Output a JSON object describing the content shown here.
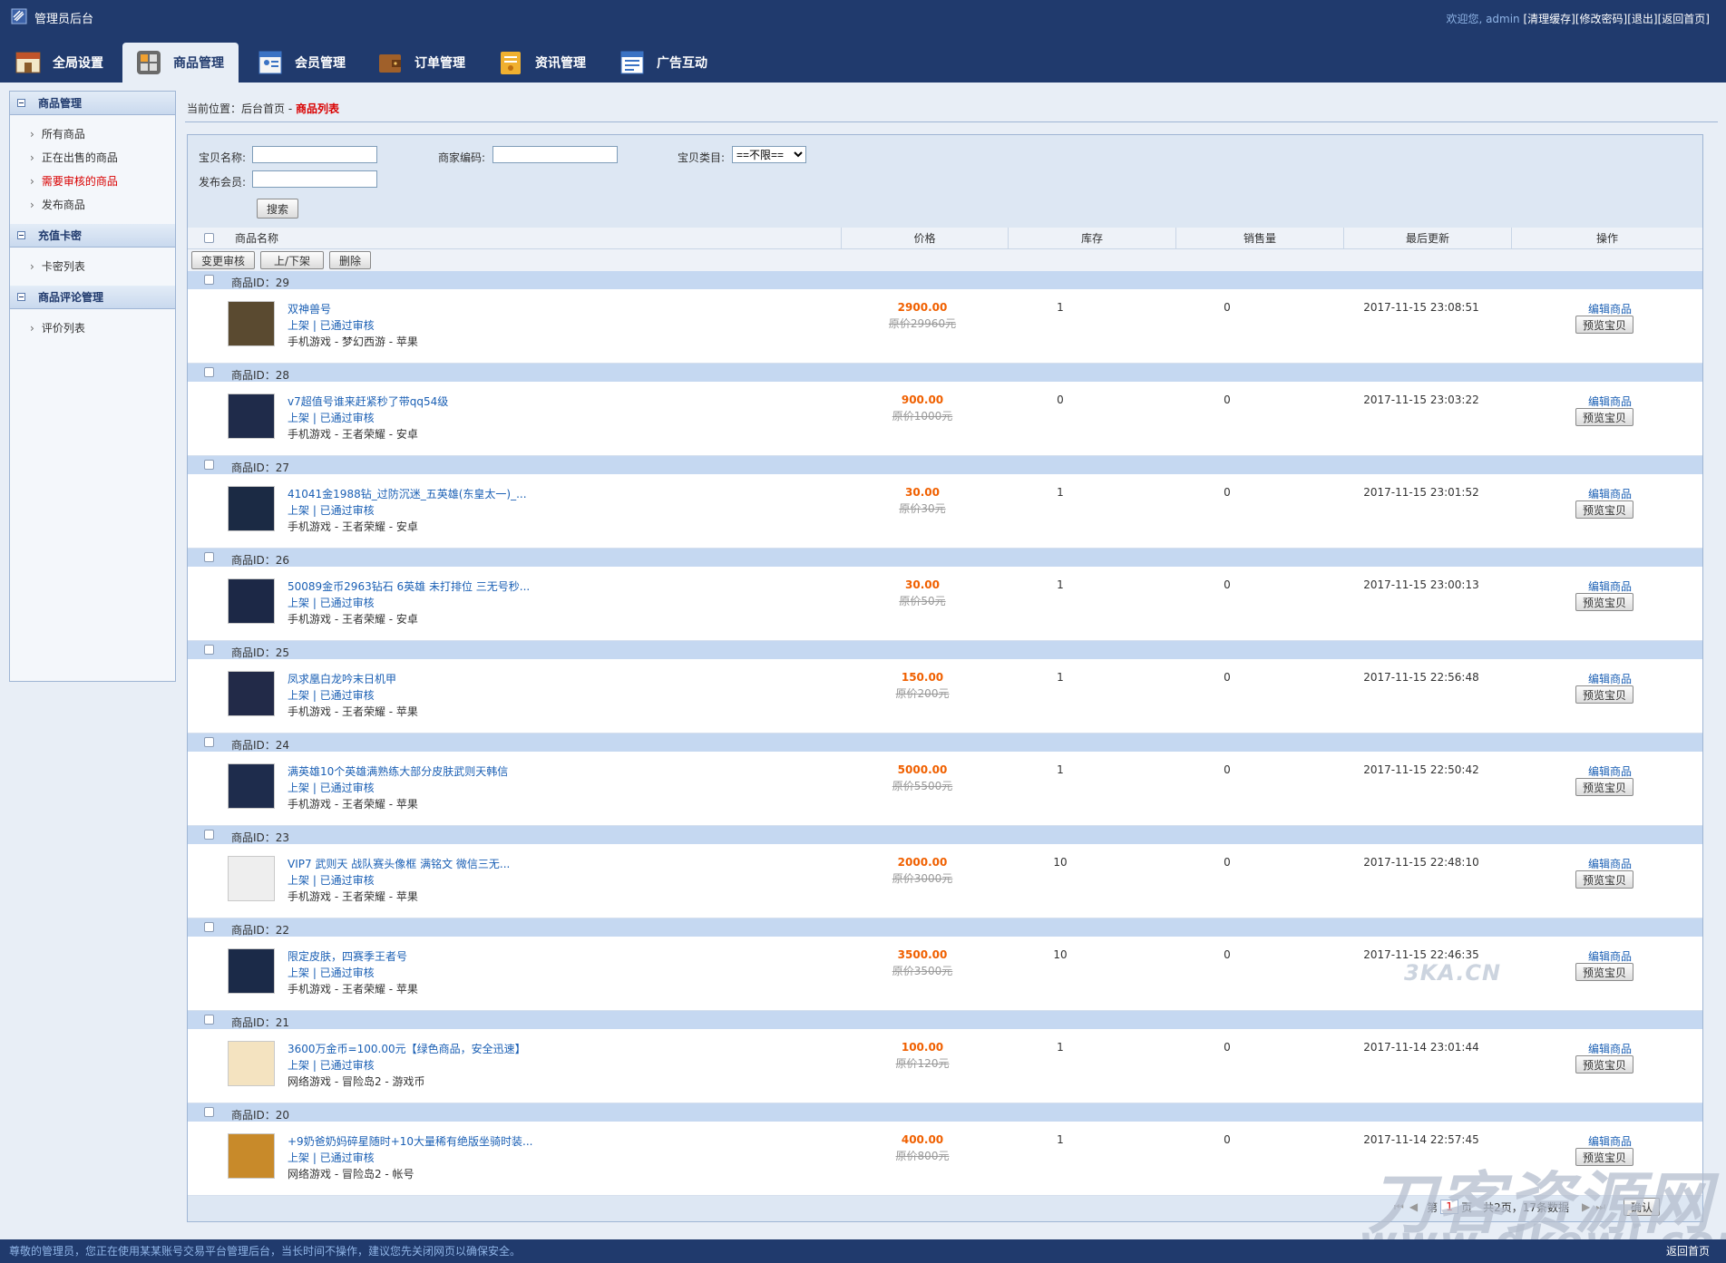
{
  "header": {
    "title": "管理员后台",
    "welcome": "欢迎您, admin",
    "links": [
      "[清理缓存]",
      "[修改密码]",
      "[退出]",
      "[返回首页]"
    ]
  },
  "nav": {
    "tabs": [
      {
        "label": "全局设置",
        "icon": "home-icon"
      },
      {
        "label": "商品管理",
        "icon": "grid-icon"
      },
      {
        "label": "会员管理",
        "icon": "member-icon"
      },
      {
        "label": "订单管理",
        "icon": "wallet-icon"
      },
      {
        "label": "资讯管理",
        "icon": "news-icon"
      },
      {
        "label": "广告互动",
        "icon": "ad-icon"
      }
    ]
  },
  "sidebar": {
    "groups": [
      {
        "title": "商品管理",
        "items": [
          "所有商品",
          "正在出售的商品",
          "需要审核的商品",
          "发布商品"
        ]
      },
      {
        "title": "充值卡密",
        "items": [
          "卡密列表"
        ]
      },
      {
        "title": "商品评论管理",
        "items": [
          "评价列表"
        ]
      }
    ]
  },
  "breadcrumb": {
    "prefix": "当前位置：",
    "home": "后台首页",
    "sep": " - ",
    "current": "商品列表"
  },
  "search": {
    "name_label": "宝贝名称:",
    "code_label": "商家编码:",
    "cat_label": "宝贝类目:",
    "cat_value": "==不限==",
    "member_label": "发布会员:",
    "search_button": "搜索"
  },
  "table": {
    "headers": [
      "商品名称",
      "价格",
      "库存",
      "销售量",
      "最后更新",
      "操作"
    ],
    "actions": [
      "变更审核",
      "上/下架",
      "删除"
    ],
    "id_prefix": "商品ID：",
    "edit_label": "编辑商品",
    "preview_label": "预览宝贝",
    "rows": [
      {
        "id": "29",
        "name": "双神兽号",
        "status": "上架 | 已通过审核",
        "category": "手机游戏 - 梦幻西游 - 苹果",
        "price": "2900.00",
        "orig": "原价29960元",
        "stock": "1",
        "sold": "0",
        "updated": "2017-11-15 23:08:51",
        "thumb": "#5a4a30"
      },
      {
        "id": "28",
        "name": "v7超值号谁来赶紧秒了带qq54级",
        "status": "上架 | 已通过审核",
        "category": "手机游戏 - 王者荣耀 - 安卓",
        "price": "900.00",
        "orig": "原价1000元",
        "stock": "0",
        "sold": "0",
        "updated": "2017-11-15 23:03:22",
        "thumb": "#1f2b4a"
      },
      {
        "id": "27",
        "name": "41041金1988钻_过防沉迷_五英雄(东皇太一)_...",
        "status": "上架 | 已通过审核",
        "category": "手机游戏 - 王者荣耀 - 安卓",
        "price": "30.00",
        "orig": "原价30元",
        "stock": "1",
        "sold": "0",
        "updated": "2017-11-15 23:01:52",
        "thumb": "#1b2a44"
      },
      {
        "id": "26",
        "name": "50089金币2963钻石 6英雄 未打排位 三无号秒...",
        "status": "上架 | 已通过审核",
        "category": "手机游戏 - 王者荣耀 - 安卓",
        "price": "30.00",
        "orig": "原价50元",
        "stock": "1",
        "sold": "0",
        "updated": "2017-11-15 23:00:13",
        "thumb": "#1c2846"
      },
      {
        "id": "25",
        "name": "凤求凰白龙吟末日机甲",
        "status": "上架 | 已通过审核",
        "category": "手机游戏 - 王者荣耀 - 苹果",
        "price": "150.00",
        "orig": "原价200元",
        "stock": "1",
        "sold": "0",
        "updated": "2017-11-15 22:56:48",
        "thumb": "#222a48"
      },
      {
        "id": "24",
        "name": "满英雄10个英雄满熟练大部分皮肤武则天韩信",
        "status": "上架 | 已通过审核",
        "category": "手机游戏 - 王者荣耀 - 苹果",
        "price": "5000.00",
        "orig": "原价5500元",
        "stock": "1",
        "sold": "0",
        "updated": "2017-11-15 22:50:42",
        "thumb": "#1e2c4c"
      },
      {
        "id": "23",
        "name": "VIP7 武则天 战队赛头像框 满铭文 微信三无...",
        "status": "上架 | 已通过审核",
        "category": "手机游戏 - 王者荣耀 - 苹果",
        "price": "2000.00",
        "orig": "原价3000元",
        "stock": "10",
        "sold": "0",
        "updated": "2017-11-15 22:48:10",
        "thumb": "#eeeeee"
      },
      {
        "id": "22",
        "name": "限定皮肤，四赛季王者号",
        "status": "上架 | 已通过审核",
        "category": "手机游戏 - 王者荣耀 - 苹果",
        "price": "3500.00",
        "orig": "原价3500元",
        "stock": "10",
        "sold": "0",
        "updated": "2017-11-15 22:46:35",
        "thumb": "#1b2a48"
      },
      {
        "id": "21",
        "name": "3600万金币=100.00元【绿色商品，安全迅速】",
        "status": "上架 | 已通过审核",
        "category": "网络游戏 - 冒险岛2 - 游戏币",
        "price": "100.00",
        "orig": "原价120元",
        "stock": "1",
        "sold": "0",
        "updated": "2017-11-14 23:01:44",
        "thumb": "#f4e3c0"
      },
      {
        "id": "20",
        "name": "+9奶爸奶妈碎星随时+10大量稀有绝版坐骑时装...",
        "status": "上架 | 已通过审核",
        "category": "网络游戏 - 冒险岛2 - 帐号",
        "price": "400.00",
        "orig": "原价800元",
        "stock": "1",
        "sold": "0",
        "updated": "2017-11-14 22:57:45",
        "thumb": "#c88a2a"
      }
    ]
  },
  "pager": {
    "prefix": "第",
    "page": "1",
    "suffix": "页",
    "summary": "共2页，17条数据",
    "confirm": "确认"
  },
  "footer": {
    "notice": "尊敬的管理员，您正在使用某某账号交易平台管理后台，当长时间不操作，建议您先关闭网页以确保安全。",
    "back": "返回首页"
  },
  "watermarks": [
    "3KA.CN",
    "刀客资源网",
    "www.dkewl.com"
  ]
}
